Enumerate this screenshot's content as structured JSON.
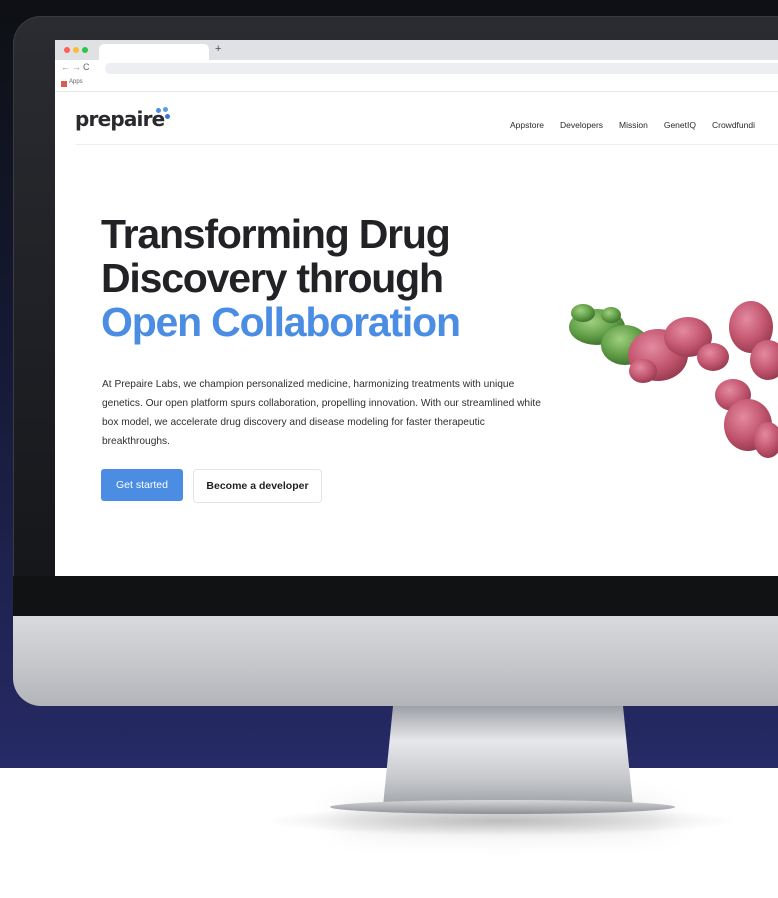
{
  "browser": {
    "new_tab_glyph": "+",
    "nav": {
      "back": "←",
      "forward": "→",
      "reload": "C"
    },
    "bookmarks": {
      "apps_label": "Apps"
    }
  },
  "site": {
    "logo_text": "prepaire",
    "nav_items": [
      "Appstore",
      "Developers",
      "Mission",
      "GenetIQ",
      "Crowdfundi"
    ],
    "hero": {
      "title_line1": "Transforming Drug",
      "title_line2": "Discovery through",
      "title_line3": "Open Collaboration",
      "paragraph": "At Prepaire Labs, we champion personalized medicine, harmonizing treatments with unique genetics. Our open platform spurs collaboration, propelling innovation. With our streamlined white box model, we accelerate drug discovery and disease modeling for faster therapeutic breakthroughs.",
      "primary_button": "Get started",
      "secondary_button": "Become a developer"
    }
  },
  "colors": {
    "accent": "#4a8de3",
    "heading": "#222226",
    "backdrop_top": "#0e1014",
    "backdrop_bottom": "#262a66",
    "molecule_green": "#6aa84f",
    "molecule_pink": "#c2566f"
  },
  "icons": [
    "traffic-lights",
    "back-arrow-icon",
    "forward-arrow-icon",
    "reload-icon",
    "apps-grid-icon",
    "prepaire-logo-mark",
    "antibody-molecule-image"
  ]
}
